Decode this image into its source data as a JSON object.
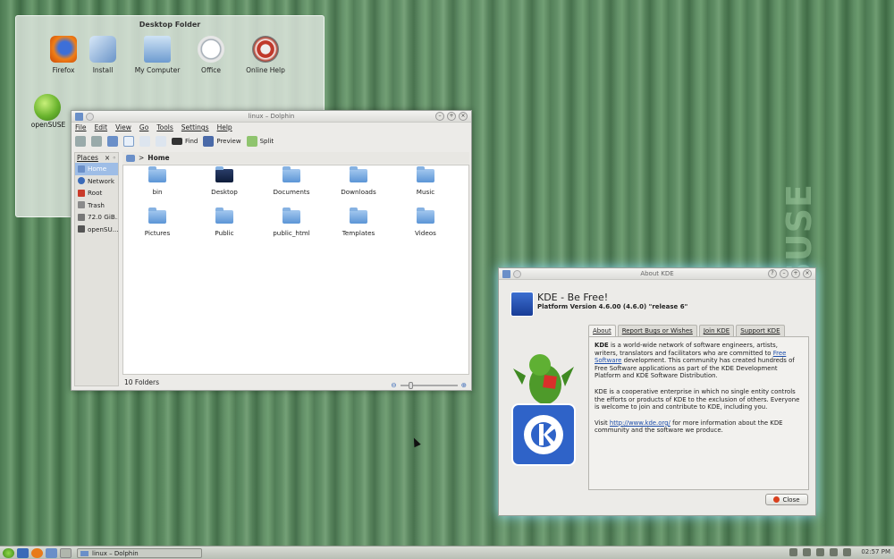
{
  "desktop": {
    "folder_title": "Desktop Folder",
    "icons": [
      {
        "label": "Firefox",
        "icon": "firefox-icon"
      },
      {
        "label": "Install",
        "icon": "install-icon"
      },
      {
        "label": "My Computer",
        "icon": "computer-icon"
      },
      {
        "label": "Office",
        "icon": "office-icon"
      },
      {
        "label": "Online Help",
        "icon": "help-lifebuoy-icon"
      }
    ],
    "opensuse_label": "openSUSE"
  },
  "dolphin": {
    "title": "linux – Dolphin",
    "menu": [
      "File",
      "Edit",
      "View",
      "Go",
      "Tools",
      "Settings",
      "Help"
    ],
    "toolbar": {
      "find": "Find",
      "preview": "Preview",
      "split": "Split"
    },
    "places_header": "Places",
    "places": [
      "Home",
      "Network",
      "Root",
      "Trash",
      "72.0 GiB...",
      "openSU..."
    ],
    "breadcrumb": "Home",
    "folders": [
      "bin",
      "Desktop",
      "Documents",
      "Downloads",
      "Music",
      "Pictures",
      "Public",
      "public_html",
      "Templates",
      "Videos"
    ],
    "status": "10 Folders",
    "zoom_fraction": 0.15
  },
  "about": {
    "title": "About KDE",
    "heading": "KDE - Be Free!",
    "platform": "Platform Version 4.6.00 (4.6.0) \"release 6\"",
    "tabs": [
      "About",
      "Report Bugs or Wishes",
      "Join KDE",
      "Support KDE"
    ],
    "p1_bold": "KDE",
    "p1a": " is a world-wide network of software engineers, artists, writers, translators and facilitators who are committed to ",
    "p1_link": "Free Software",
    "p1b": " development. This community has created hundreds of Free Software applications as part of the KDE Development Platform and KDE Software Distribution.",
    "p2": "KDE is a cooperative enterprise in which no single entity controls the efforts or products of KDE to the exclusion of others. Everyone is welcome to join and contribute to KDE, including you.",
    "p3a": "Visit ",
    "p3_link": "http://www.kde.org/",
    "p3b": " for more information about the KDE community and the software we produce.",
    "close": "Close"
  },
  "taskbar": {
    "task_label": "linux – Dolphin",
    "clock": "02:57 PM"
  },
  "background_brand": "SUSE",
  "colors": {
    "accent": "#9ebde6",
    "desktop_green": "#5b8a60",
    "link": "#1e4eaa"
  }
}
